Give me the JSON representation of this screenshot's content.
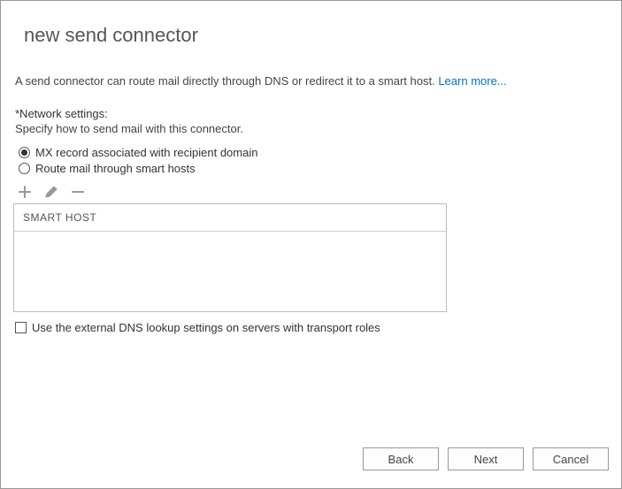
{
  "title": "new send connector",
  "description_prefix": "A send connector can route mail directly through DNS or redirect it to a smart host. ",
  "learn_more": "Learn more...",
  "network_label": "*Network settings:",
  "network_hint": "Specify how to send mail with this connector.",
  "options": {
    "mx": "MX record associated with recipient domain",
    "smarthost": "Route mail through smart hosts"
  },
  "grid": {
    "header": "SMART HOST"
  },
  "checkbox_label": "Use the external DNS lookup settings on servers with transport roles",
  "buttons": {
    "back": "Back",
    "next": "Next",
    "cancel": "Cancel"
  }
}
